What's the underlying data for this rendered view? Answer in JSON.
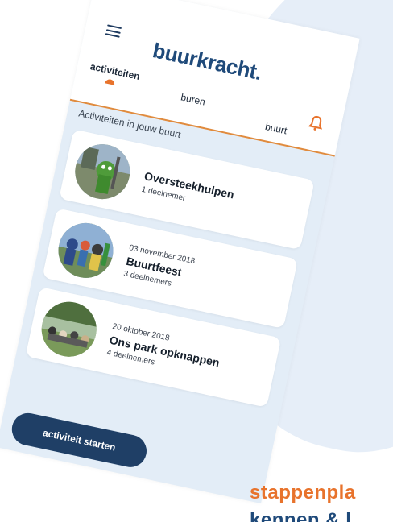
{
  "header": {
    "brand": "buurkracht.",
    "tabs": [
      {
        "label": "activiteiten",
        "active": true
      },
      {
        "label": "buren",
        "active": false
      },
      {
        "label": "buurt",
        "active": false
      }
    ],
    "icons": {
      "menu": "hamburger-menu-icon",
      "notifications": "bell-icon"
    }
  },
  "section": {
    "heading": "Activiteiten in jouw buurt"
  },
  "activities": [
    {
      "date": "",
      "title": "Oversteekhulpen",
      "participants": "1 deelnemer"
    },
    {
      "date": "03 november 2018",
      "title": "Buurtfeest",
      "participants": "3 deelnemers"
    },
    {
      "date": "20 oktober 2018",
      "title": "Ons park opknappen",
      "participants": "4 deelnemers"
    }
  ],
  "cta": {
    "label": "activiteit starten"
  },
  "footer": {
    "title": "stappenpla",
    "subtitle": "kennen & l"
  },
  "colors": {
    "brand": "#1f4a7a",
    "accent": "#e8732c",
    "cta": "#1f3f66",
    "background": "#e3edf7"
  }
}
